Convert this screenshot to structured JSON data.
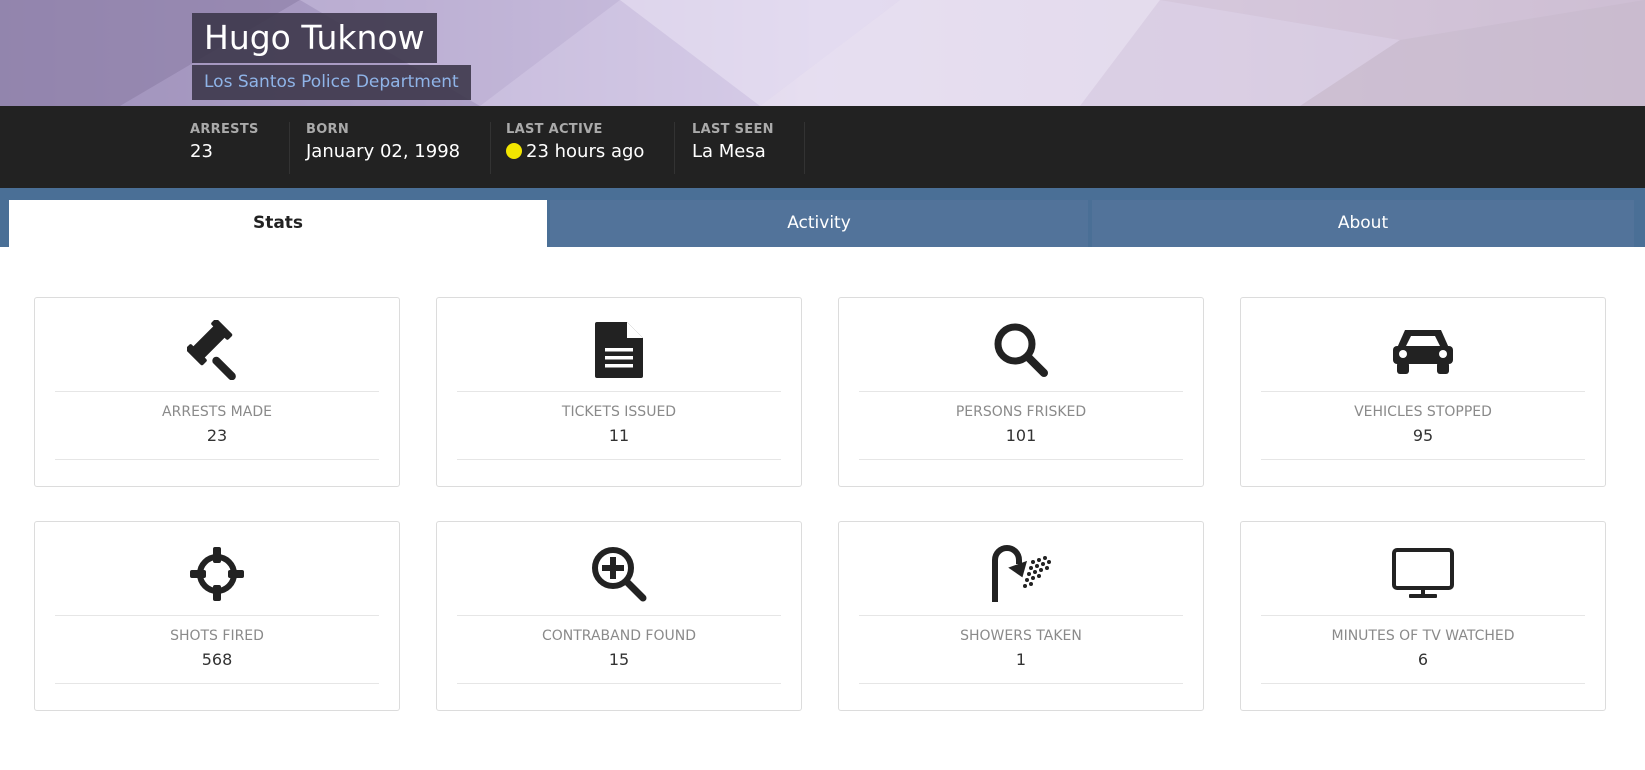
{
  "profile": {
    "name": "Hugo Tuknow",
    "department": "Los Santos Police Department"
  },
  "summary": [
    {
      "label": "ARRESTS",
      "value": "23"
    },
    {
      "label": "BORN",
      "value": "January 02, 1998"
    },
    {
      "label": "LAST ACTIVE",
      "value": "23 hours ago",
      "status_color": "#f2e600"
    },
    {
      "label": "LAST SEEN",
      "value": "La Mesa"
    }
  ],
  "tabs": [
    {
      "label": "Stats",
      "active": true
    },
    {
      "label": "Activity",
      "active": false
    },
    {
      "label": "About",
      "active": false
    }
  ],
  "stats": [
    {
      "label": "Arrests Made",
      "value": "23",
      "icon": "gavel-icon"
    },
    {
      "label": "Tickets Issued",
      "value": "11",
      "icon": "document-icon"
    },
    {
      "label": "Persons Frisked",
      "value": "101",
      "icon": "search-icon"
    },
    {
      "label": "Vehicles Stopped",
      "value": "95",
      "icon": "car-icon"
    },
    {
      "label": "Shots Fired",
      "value": "568",
      "icon": "crosshair-icon"
    },
    {
      "label": "Contraband Found",
      "value": "15",
      "icon": "zoom-in-icon"
    },
    {
      "label": "Showers Taken",
      "value": "1",
      "icon": "shower-icon"
    },
    {
      "label": "Minutes of TV Watched",
      "value": "6",
      "icon": "tv-icon"
    }
  ],
  "colors": {
    "stats_bar": "#222222",
    "tabs_bar": "#4a6f96",
    "tab_inactive": "#52739a",
    "department_text": "#8fb4e8"
  }
}
